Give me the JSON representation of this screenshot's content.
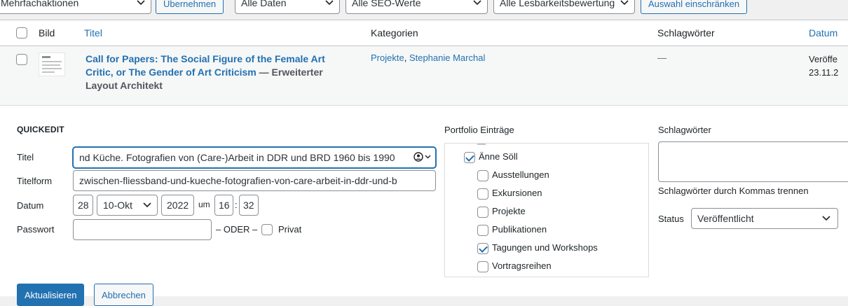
{
  "bulk": {
    "actions_label": "Mehrfachaktionen",
    "apply_label": "Übernehmen",
    "dates_label": "Alle Daten",
    "seo_label": "Alle SEO-Werte",
    "readability_label": "Alle Lesbarkeitsbewertung",
    "filter_label": "Auswahl einschränken"
  },
  "table": {
    "headers": {
      "image": "Bild",
      "title": "Titel",
      "categories": "Kategorien",
      "tags": "Schlagwörter",
      "date": "Datum"
    },
    "row": {
      "title_link": "Call for Papers: The Social Figure of the Female Art Critic, or The Gender of Art Criticism",
      "title_suffix": " — Erweiterter Layout Architekt",
      "categories": [
        "Projekte",
        "Stephanie Marchal"
      ],
      "category_separator": ", ",
      "tags": "—",
      "date_status": "Veröffe",
      "date_value": "23.11.2"
    }
  },
  "quickedit": {
    "heading": "QUICKEDIT",
    "title_label": "Titel",
    "title_value": "nd Küche. Fotografien von (Care-)Arbeit in DDR und BRD 1960 bis 1990",
    "slug_label": "Titelform",
    "slug_value": "zwischen-fliessband-und-kueche-fotografien-von-care-arbeit-in-ddr-und-b",
    "date_label": "Datum",
    "date_day": "28",
    "date_month": "10-Okt",
    "date_year": "2022",
    "date_at": "um",
    "date_hour": "16",
    "date_colon": ":",
    "date_minute": "32",
    "password_label": "Passwort",
    "password_value": "",
    "or_label": "– ODER –",
    "private_label": "Privat",
    "portfolio_label": "Portfolio Einträge",
    "portfolio_items": [
      {
        "label": "Änne Söll",
        "checked": true,
        "level": 0
      },
      {
        "label": "Ausstellungen",
        "checked": false,
        "level": 1
      },
      {
        "label": "Exkursionen",
        "checked": false,
        "level": 1
      },
      {
        "label": "Projekte",
        "checked": false,
        "level": 1
      },
      {
        "label": "Publikationen",
        "checked": false,
        "level": 1
      },
      {
        "label": "Tagungen und Workshops",
        "checked": true,
        "level": 1
      },
      {
        "label": "Vortragsreihen",
        "checked": false,
        "level": 1
      }
    ],
    "tags_label": "Schlagwörter",
    "tags_value": "",
    "tags_hint": "Schlagwörter durch Kommas trennen",
    "status_label": "Status",
    "status_value": "Veröffentlicht",
    "update_label": "Aktualisieren",
    "cancel_label": "Abbrechen"
  },
  "colors": {
    "accent": "#2271b1",
    "text": "#1d2327",
    "border": "#8c8f94"
  }
}
